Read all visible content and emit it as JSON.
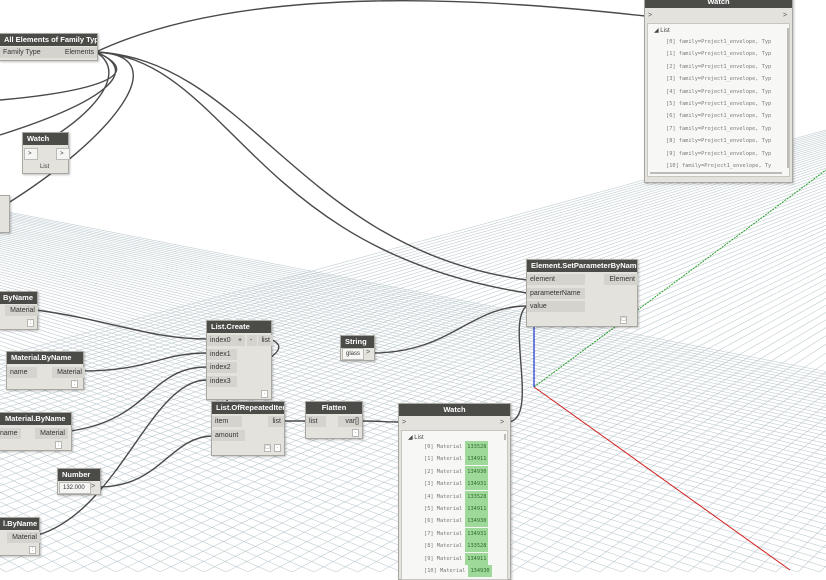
{
  "nodes": {
    "all_elements": {
      "title": "All Elements of Family Type",
      "input": "Family Type",
      "output": "Elements"
    },
    "watch_top": {
      "title": "Watch",
      "input": ">",
      "output": ">",
      "list_label": "List",
      "rows": [
        "[0] family=Project1_envelope, Typ",
        "[1] family=Project1_envelope, Typ",
        "[2] family=Project1_envelope, Typ",
        "[3] family=Project1_envelope, Typ",
        "[4] family=Project1_envelope, Typ",
        "[5] family=Project1_envelope, Typ",
        "[6] family=Project1_envelope, Typ",
        "[7] family=Project1_envelope, Typ",
        "[8] family=Project1_envelope, Typ",
        "[9] family=Project1_envelope, Typ",
        "[10] family=Project1_envelope, Ty"
      ]
    },
    "watch_small": {
      "title": "Watch",
      "input": ">",
      "output": ">",
      "list_label": "List"
    },
    "bynm_1": {
      "title": "ByName",
      "output": "Material"
    },
    "bynm_2": {
      "title": "Material.ByName",
      "input": "name",
      "output": "Material"
    },
    "bynm_3": {
      "title": "Material.ByName",
      "input": "name",
      "output": "Material"
    },
    "bynm_4": {
      "title": "l.ByName",
      "output": "Material"
    },
    "list_create": {
      "title": "List.Create",
      "inputs": [
        "index0",
        "index1",
        "index2",
        "index3"
      ],
      "plus": "+",
      "minus": "-",
      "output": "list"
    },
    "repeated": {
      "title": "List.OfRepeatedItem",
      "inputs": [
        "item",
        "amount"
      ],
      "output": "list"
    },
    "flatten": {
      "title": "Flatten",
      "input": "list",
      "output": "var[]"
    },
    "number": {
      "title": "Number",
      "value": "132.000",
      "output": ">"
    },
    "string": {
      "title": "String",
      "value": "glass",
      "output": ">"
    },
    "setparam": {
      "title": "Element.SetParameterByName",
      "inputs": [
        "element",
        "parameterName",
        "value"
      ],
      "output": "Element"
    },
    "watch_bottom": {
      "title": "Watch",
      "input": ">",
      "output": ">",
      "list_label": "List",
      "rows": [
        {
          "idx": "[0] Material",
          "val": "133528"
        },
        {
          "idx": "[1] Material",
          "val": "134911"
        },
        {
          "idx": "[2] Material",
          "val": "134930"
        },
        {
          "idx": "[3] Material",
          "val": "134931"
        },
        {
          "idx": "[4] Material",
          "val": "133528"
        },
        {
          "idx": "[5] Material",
          "val": "134911"
        },
        {
          "idx": "[6] Material",
          "val": "134930"
        },
        {
          "idx": "[7] Material",
          "val": "134931"
        },
        {
          "idx": "[8] Material",
          "val": "133528"
        },
        {
          "idx": "[9] Material",
          "val": "134911"
        },
        {
          "idx": "[10] Material",
          "val": "134930"
        }
      ]
    }
  },
  "colors": {
    "header": "#4b4b48",
    "node_body": "#e4e2dd",
    "wire": "#4a4a4a",
    "grid": "#b9c6cc",
    "value_chip": "#9fd99a",
    "axis_x": "#d02020",
    "axis_y": "#2aa02a",
    "axis_z": "#1a2fd0"
  }
}
